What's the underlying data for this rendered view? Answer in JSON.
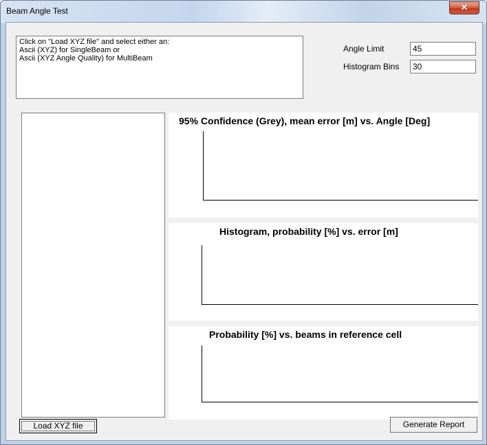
{
  "window": {
    "title": "Beam Angle Test",
    "close_icon": "close-icon"
  },
  "instructions": {
    "lines": [
      "Click on \"Load XYZ file\" and select either an:",
      "Ascii (XYZ) for SingleBeam or",
      "Ascii (XYZ Angle Quality) for MultiBeam"
    ]
  },
  "params": {
    "angle_limit_label": "Angle Limit",
    "angle_limit_value": "45",
    "histogram_bins_label": "Histogram Bins",
    "histogram_bins_value": "30"
  },
  "plots": {
    "confidence_title": "95% Confidence (Grey), mean error [m] vs. Angle [Deg]",
    "histogram_title": "Histogram, probability [%] vs. error [m]",
    "probability_title": "Probability [%] vs. beams in reference cell"
  },
  "buttons": {
    "load_label": "Load XYZ file",
    "report_label": "Generate Report"
  }
}
